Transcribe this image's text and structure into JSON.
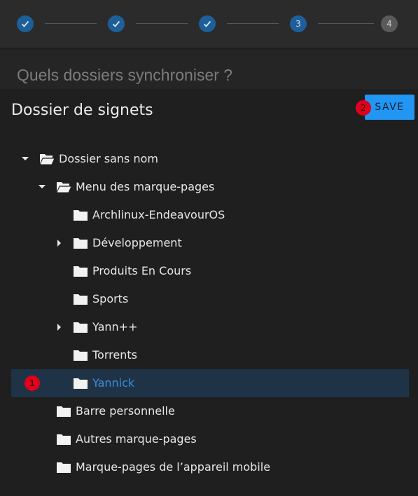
{
  "stepper": {
    "steps": [
      {
        "state": "done",
        "label": ""
      },
      {
        "state": "done",
        "label": ""
      },
      {
        "state": "done",
        "label": ""
      },
      {
        "state": "active",
        "label": "3"
      },
      {
        "state": "todo",
        "label": "4"
      }
    ]
  },
  "page": {
    "title": "Quels dossiers synchroniser ?"
  },
  "dialog": {
    "title": "Dossier de signets",
    "save_label": "SAVE",
    "save_badge": "2",
    "selected_badge": "1"
  },
  "tree": {
    "items": [
      {
        "label": "Dossier sans nom",
        "icon": "folder-open-icon",
        "caret": "down"
      },
      {
        "label": "Menu des marque-pages",
        "icon": "folder-open-icon",
        "caret": "down"
      },
      {
        "label": "Archlinux-EndeavourOS",
        "icon": "folder-icon",
        "caret": ""
      },
      {
        "label": "Développement",
        "icon": "folder-icon",
        "caret": "right"
      },
      {
        "label": "Produits En Cours",
        "icon": "folder-icon",
        "caret": ""
      },
      {
        "label": "Sports",
        "icon": "folder-icon",
        "caret": ""
      },
      {
        "label": "Yann++",
        "icon": "folder-icon",
        "caret": "right"
      },
      {
        "label": "Torrents",
        "icon": "folder-icon",
        "caret": ""
      },
      {
        "label": "Yannick",
        "icon": "folder-icon",
        "caret": "",
        "selected": true
      },
      {
        "label": "Barre personnelle",
        "icon": "folder-icon",
        "caret": ""
      },
      {
        "label": "Autres marque-pages",
        "icon": "folder-icon",
        "caret": ""
      },
      {
        "label": "Marque-pages de l’appareil mobile",
        "icon": "folder-icon",
        "caret": ""
      }
    ]
  },
  "colors": {
    "accent": "#2196f3",
    "selected_row": "#1f3347",
    "badge": "#e0001b"
  }
}
